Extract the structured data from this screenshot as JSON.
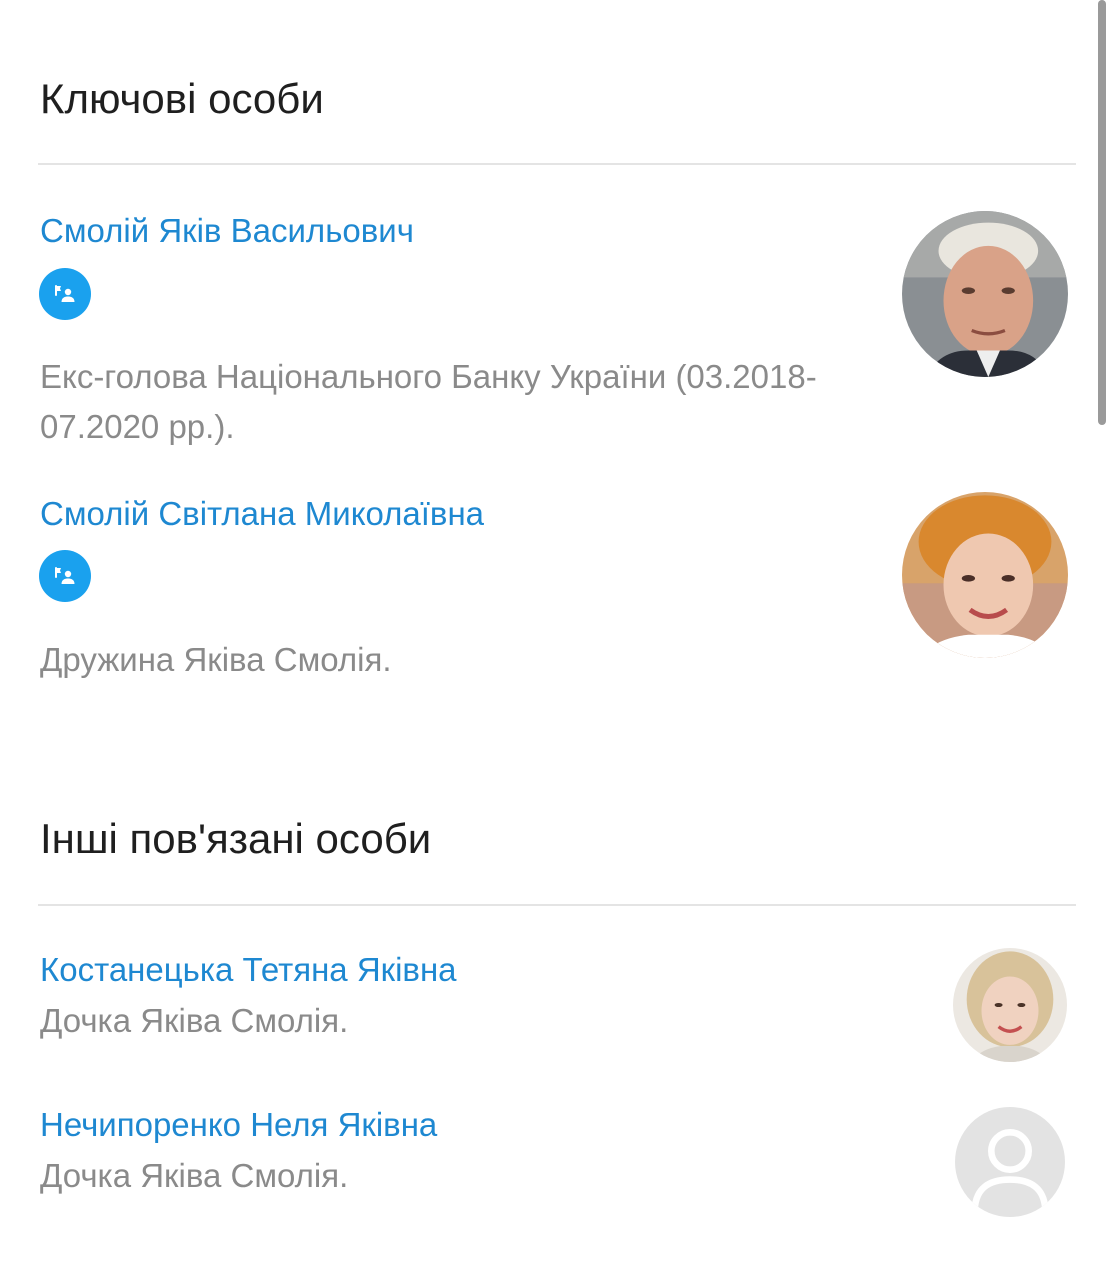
{
  "key_persons": {
    "title": "Ключові особи",
    "persons": [
      {
        "name": "Смолій Яків Васильович",
        "badge_icon": "person-flag-icon",
        "description": "Екс-голова Національного Банку України (03.2018-07.2020 рр.)."
      },
      {
        "name": "Смолій Світлана Миколаївна",
        "badge_icon": "person-flag-icon",
        "description": "Дружина Яківа Смолія."
      }
    ]
  },
  "related_persons": {
    "title": "Інші пов'язані особи",
    "persons": [
      {
        "name": "Костанецька Тетяна Яківна",
        "description": "Дочка Яківа Смолія."
      },
      {
        "name": "Нечипоренко Неля Яківна",
        "description": "Дочка Яківа Смолія.",
        "avatar_icon": "user-placeholder-icon"
      }
    ]
  },
  "colors": {
    "link": "#1e88d1",
    "badge": "#1aa1ee",
    "muted_text": "#8a8a8a",
    "heading": "#1f1f1f",
    "divider": "#e4e4e4"
  }
}
